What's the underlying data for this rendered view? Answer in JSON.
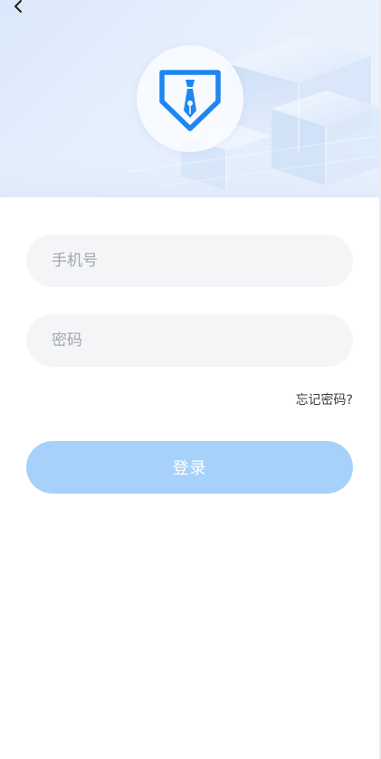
{
  "header": {
    "back_icon": "chevron-left-icon",
    "logo_icon": "pen-nib-tie-icon"
  },
  "form": {
    "phone_placeholder": "手机号",
    "phone_value": "",
    "password_placeholder": "密码",
    "password_value": "",
    "forgot_password_label": "忘记密码?",
    "login_label": "登录"
  },
  "colors": {
    "accent": "#1e86f0",
    "login_button": "#a6d1fb",
    "field_background": "#f4f5f7",
    "header_background": "#dfeafb"
  }
}
